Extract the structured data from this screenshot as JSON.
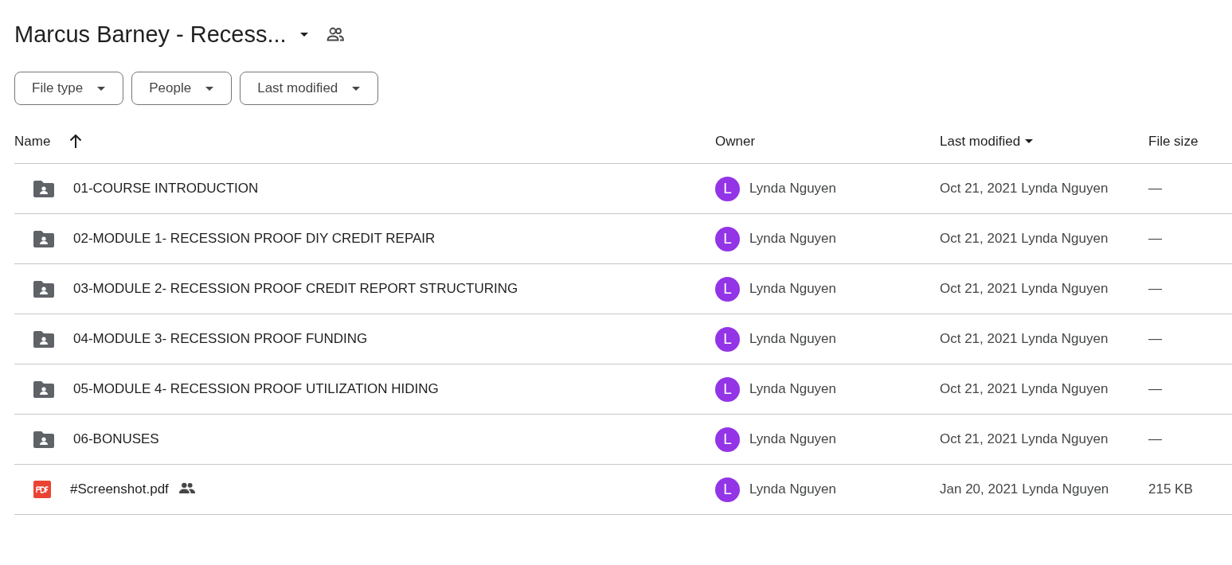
{
  "header": {
    "title": "Marcus Barney - Recess...",
    "shared": true
  },
  "filters": [
    {
      "label": "File type"
    },
    {
      "label": "People"
    },
    {
      "label": "Last modified"
    }
  ],
  "table": {
    "columns": [
      {
        "label": "Name",
        "sorted": true,
        "ascending": true
      },
      {
        "label": "Owner",
        "sorted": false
      },
      {
        "label": "Last modified",
        "sorted": true,
        "ascending": false
      },
      {
        "label": "File size",
        "sorted": false
      }
    ],
    "rows": [
      {
        "kind": "folder",
        "name": "01-COURSE INTRODUCTION",
        "shared": false,
        "owner": "Lynda Nguyen",
        "avatar": "L",
        "color": "#9334e6",
        "date": "Oct 21, 2021",
        "modified_by": "Lynda Nguyen",
        "size": "—"
      },
      {
        "kind": "folder",
        "name": "02-MODULE 1- RECESSION PROOF DIY CREDIT REPAIR",
        "shared": false,
        "owner": "Lynda Nguyen",
        "avatar": "L",
        "color": "#9334e6",
        "date": "Oct 21, 2021",
        "modified_by": "Lynda Nguyen",
        "size": "—"
      },
      {
        "kind": "folder",
        "name": "03-MODULE 2- RECESSION PROOF CREDIT REPORT STRUCTURING",
        "shared": false,
        "owner": "Lynda Nguyen",
        "avatar": "L",
        "color": "#9334e6",
        "date": "Oct 21, 2021",
        "modified_by": "Lynda Nguyen",
        "size": "—"
      },
      {
        "kind": "folder",
        "name": "04-MODULE 3- RECESSION PROOF FUNDING",
        "shared": false,
        "owner": "Lynda Nguyen",
        "avatar": "L",
        "color": "#9334e6",
        "date": "Oct 21, 2021",
        "modified_by": "Lynda Nguyen",
        "size": "—"
      },
      {
        "kind": "folder",
        "name": "05-MODULE 4- RECESSION PROOF UTILIZATION HIDING",
        "shared": false,
        "owner": "Lynda Nguyen",
        "avatar": "L",
        "color": "#9334e6",
        "date": "Oct 21, 2021",
        "modified_by": "Lynda Nguyen",
        "size": "—"
      },
      {
        "kind": "folder",
        "name": "06-BONUSES",
        "shared": false,
        "owner": "Lynda Nguyen",
        "avatar": "L",
        "color": "#9334e6",
        "date": "Oct 21, 2021",
        "modified_by": "Lynda Nguyen",
        "size": "—"
      },
      {
        "kind": "pdf",
        "name": "#Screenshot.pdf",
        "shared": true,
        "owner": "Lynda Nguyen",
        "avatar": "L",
        "color": "#9334e6",
        "date": "Jan 20, 2021",
        "modified_by": "Lynda Nguyen",
        "size": "215 KB"
      }
    ]
  }
}
